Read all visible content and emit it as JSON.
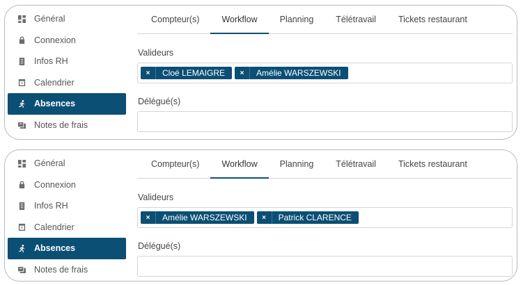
{
  "panels": [
    {
      "sidebar": {
        "items": [
          {
            "label": "Général",
            "icon": "dashboard-icon"
          },
          {
            "label": "Connexion",
            "icon": "lock-icon"
          },
          {
            "label": "Infos RH",
            "icon": "id-card-icon"
          },
          {
            "label": "Calendrier",
            "icon": "calendar-icon"
          },
          {
            "label": "Absences",
            "icon": "running-person-icon",
            "active": true
          },
          {
            "label": "Notes de frais",
            "icon": "receipt-icon"
          }
        ]
      },
      "tabs": [
        {
          "label": "Compteur(s)"
        },
        {
          "label": "Workflow",
          "active": true
        },
        {
          "label": "Planning"
        },
        {
          "label": "Télétravail"
        },
        {
          "label": "Tickets restaurant"
        }
      ],
      "validators_label": "Valideurs",
      "validators": [
        "Cloé LEMAIGRE",
        "Amélie WARSZEWSKI"
      ],
      "delegates_label": "Délégué(s)",
      "delegates": []
    },
    {
      "sidebar": {
        "items": [
          {
            "label": "Général",
            "icon": "dashboard-icon"
          },
          {
            "label": "Connexion",
            "icon": "lock-icon"
          },
          {
            "label": "Infos RH",
            "icon": "id-card-icon"
          },
          {
            "label": "Calendrier",
            "icon": "calendar-icon"
          },
          {
            "label": "Absences",
            "icon": "running-person-icon",
            "active": true
          },
          {
            "label": "Notes de frais",
            "icon": "receipt-icon"
          }
        ]
      },
      "tabs": [
        {
          "label": "Compteur(s)"
        },
        {
          "label": "Workflow",
          "active": true
        },
        {
          "label": "Planning"
        },
        {
          "label": "Télétravail"
        },
        {
          "label": "Tickets restaurant"
        }
      ],
      "validators_label": "Valideurs",
      "validators": [
        "Amélie WARSZEWSKI",
        "Patrick CLARENCE"
      ],
      "delegates_label": "Délégué(s)",
      "delegates": []
    }
  ],
  "chip_remove_symbol": "×",
  "colors": {
    "accent": "#0b4f74",
    "border": "#d5d5d5"
  }
}
